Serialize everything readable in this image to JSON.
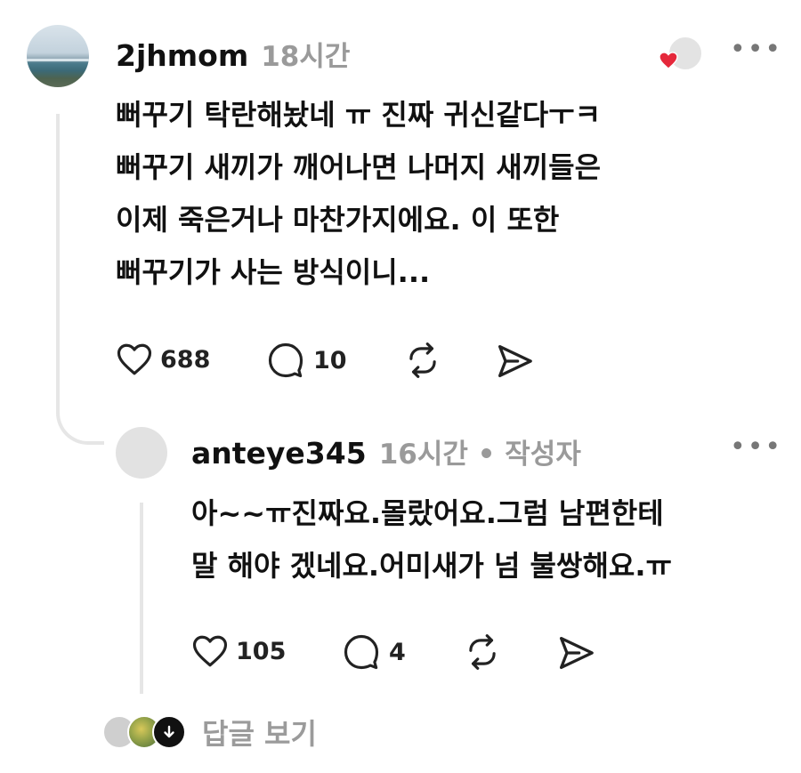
{
  "comment": {
    "username": "2jhmom",
    "time": "18시간",
    "lines": [
      "뻐꾸기 탁란해놨네 ㅠ 진짜 귀신같다ㅜㅋ",
      "뻐꾸기 새끼가 깨어나면 나머지 새끼들은",
      "이제 죽은거나 마찬가지에요. 이 또한",
      "뻐꾸기가 사는 방식이니..."
    ],
    "likes": "688",
    "replies": "10"
  },
  "reply": {
    "username": "anteye345",
    "meta": "16시간 • 작성자",
    "lines": [
      "아~~ㅠ진짜요.몰랐어요.그럼 남편한테",
      "말 해야 겠네요.어미새가 넘 불쌍해요.ㅠ"
    ],
    "likes": "105",
    "replies": "4"
  },
  "footer": {
    "view_replies": "답글 보기"
  },
  "colors": {
    "heart_badge": "#e5283b",
    "muted": "#9a9a9a"
  }
}
